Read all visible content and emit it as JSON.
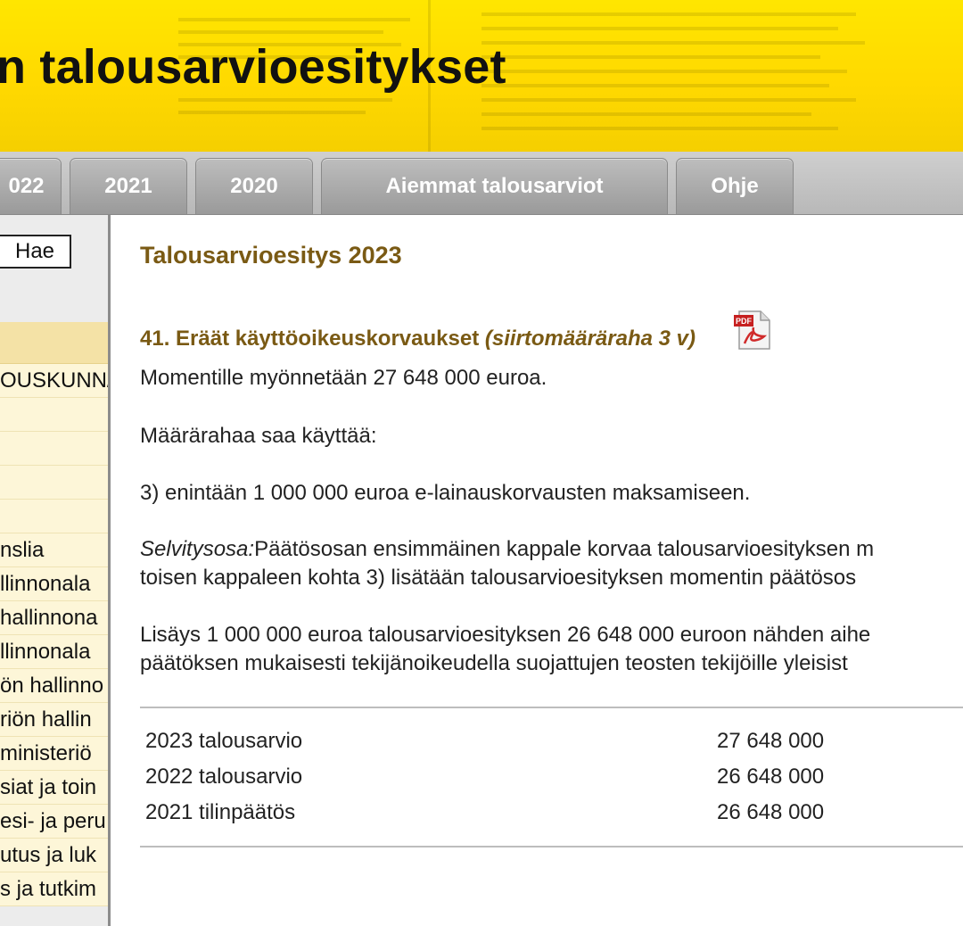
{
  "header": {
    "title": "n talousarvioesitykset"
  },
  "tabs": [
    {
      "label": "022"
    },
    {
      "label": "2021"
    },
    {
      "label": "2020"
    },
    {
      "label": "Aiemmat talousarviot"
    },
    {
      "label": "Ohje"
    }
  ],
  "sidebar": {
    "search_button": "Hae",
    "items": [
      {
        "label": "OUSKUNN/"
      },
      {
        "label": ""
      },
      {
        "label": ""
      },
      {
        "label": ""
      },
      {
        "label": ""
      },
      {
        "label": "nslia"
      },
      {
        "label": "llinnonala"
      },
      {
        "label": "hallinnona"
      },
      {
        "label": "llinnonala"
      },
      {
        "label": "ön hallinno"
      },
      {
        "label": "riön hallin"
      },
      {
        "label": "ministeriö"
      },
      {
        "label": "siat ja toin"
      },
      {
        "label": "esi- ja peru"
      },
      {
        "label": "utus ja luk"
      },
      {
        "label": "s ja tutkim"
      }
    ]
  },
  "main": {
    "page_heading": "Talousarvioesitys 2023",
    "moment_heading": "41. Eräät käyttöoikeuskorvaukset ",
    "moment_heading_italic": "(siirtomääräraha 3 v)",
    "pdf_icon": "pdf-icon",
    "paragraphs": {
      "p1": "Momentille myönnetään 27 648 000 euroa.",
      "p2": "Määrärahaa saa käyttää:",
      "p3": "3) enintään 1 000 000 euroa e-lainauskorvausten maksamiseen.",
      "p4_label": "Selvitysosa:",
      "p4_line1": "Päätösosan ensimmäinen kappale korvaa talousarvioesityksen m",
      "p4_line2": "toisen kappaleen kohta 3) lisätään talousarvioesityksen momentin päätösos",
      "p5_line1": "Lisäys 1 000 000 euroa talousarvioesityksen 26 648 000 euroon nähden aihe",
      "p5_line2": "päätöksen mukaisesti tekijänoikeudella suojattujen teosten tekijöille yleisist"
    },
    "figures": [
      {
        "label": "2023 talousarvio",
        "value": "27 648 000"
      },
      {
        "label": "2022 talousarvio",
        "value": "26 648 000"
      },
      {
        "label": "2021 tilinpäätös",
        "value": "26 648 000"
      }
    ]
  },
  "colors": {
    "banner": "#ffe600",
    "heading": "#7a5a14",
    "tab": "#a8a8a8",
    "sidebar_item": "#fdf6d8"
  }
}
